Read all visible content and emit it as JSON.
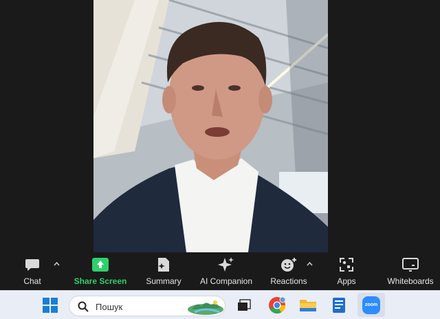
{
  "toolbar": {
    "chat_label": "Chat",
    "share_label": "Share Screen",
    "summary_label": "Summary",
    "ai_label": "AI Companion",
    "reactions_label": "Reactions",
    "apps_label": "Apps",
    "whiteboards_label": "Whiteboards"
  },
  "taskbar": {
    "search_placeholder": "Пошук",
    "zoom_icon_text": "zoom"
  },
  "colors": {
    "toolbar_bg": "#1a1a1a",
    "share_accent": "#2fcf6b",
    "taskbar_bg": "#e9edf5",
    "zoom_blue": "#2d8cff"
  }
}
